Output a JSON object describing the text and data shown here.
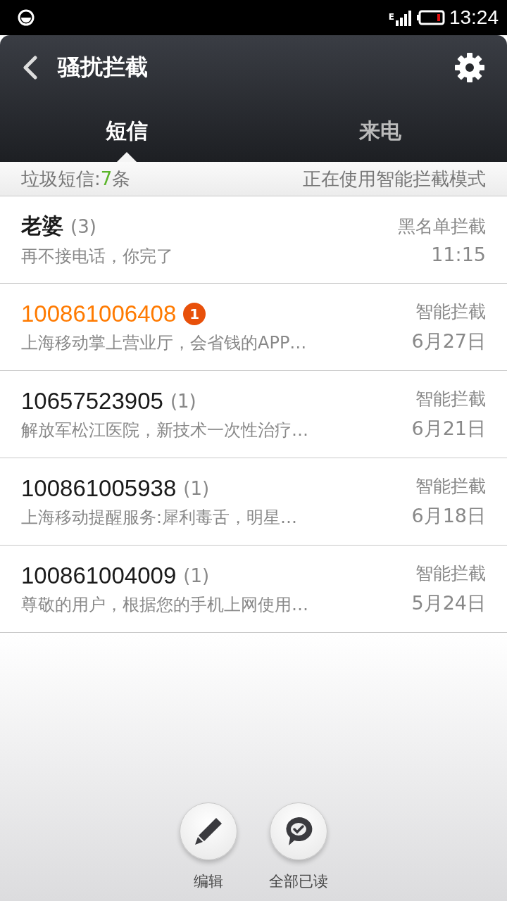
{
  "status_bar": {
    "network": "E",
    "time": "13:24"
  },
  "header": {
    "title": "骚扰拦截"
  },
  "tabs": [
    {
      "label": "短信",
      "selected": true
    },
    {
      "label": "来电",
      "selected": false
    }
  ],
  "summary": {
    "prefix": "垃圾短信:",
    "count": "7",
    "suffix": "条",
    "mode": "正在使用智能拦截模式"
  },
  "messages": [
    {
      "sender": "老婆",
      "count": "(3)",
      "unread": false,
      "preview": "再不接电话，你完了",
      "rule": "黑名单拦截",
      "time": "11:15"
    },
    {
      "sender": "100861006408",
      "unread": true,
      "badge": "1",
      "preview": "上海移动掌上营业厅，会省钱的APP…",
      "rule": "智能拦截",
      "time": "6月27日"
    },
    {
      "sender": "10657523905",
      "count": "(1)",
      "unread": false,
      "preview": "解放军松江医院，新技术一次性治疗…",
      "rule": "智能拦截",
      "time": "6月21日"
    },
    {
      "sender": "100861005938",
      "count": "(1)",
      "unread": false,
      "preview": "上海移动提醒服务:犀利毒舌，明星…",
      "rule": "智能拦截",
      "time": "6月18日"
    },
    {
      "sender": "100861004009",
      "count": "(1)",
      "unread": false,
      "preview": "尊敬的用户，根据您的手机上网使用…",
      "rule": "智能拦截",
      "time": "5月24日"
    }
  ],
  "actions": [
    {
      "kind": "edit",
      "label": "编辑"
    },
    {
      "kind": "read_all",
      "label": "全部已读"
    }
  ]
}
